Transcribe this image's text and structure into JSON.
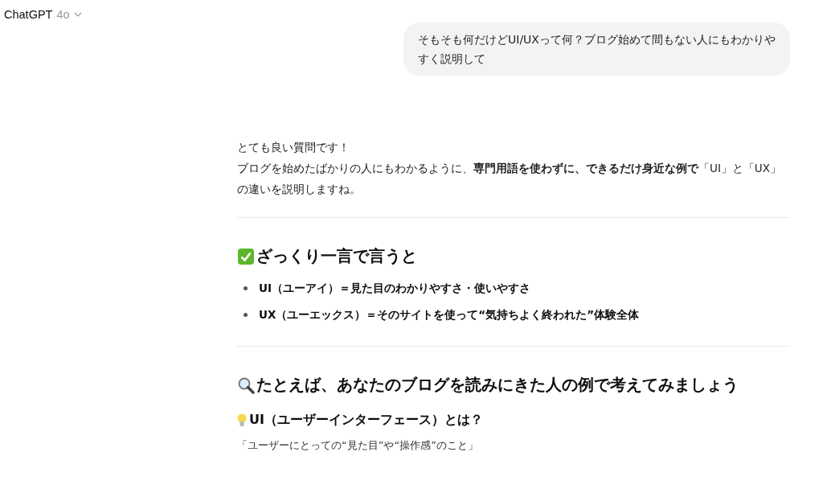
{
  "header": {
    "app_name": "ChatGPT",
    "model": "4o"
  },
  "user_message": "そもそも何だけどUI/UXって何？ブログ始めて間もない人にもわかりやすく説明して",
  "reply": {
    "paragraphs": [
      "とても良い質問です！",
      "ブログを始めたばかりの人にもわかるように、**専門用語を使わずに、できるだけ身近な例で**「UI」と「UX」の違いを説明しますね。"
    ],
    "sections": [
      {
        "kind": "summary",
        "heading": "ざっくり一言で言うと",
        "bullets": [
          "UI（ユーアイ）＝見た目のわかりやすさ・使いやすさ",
          "UX（ユーエックス）＝そのサイトを使って“気持ちよく終われた”体験全体"
        ]
      },
      {
        "kind": "example",
        "heading": "たとえば、あなたのブログを読みにきた人の例で考えてみましょう",
        "subsections": [
          {
            "kind": "idea",
            "heading": "UI（ユーザーインターフェース）とは？",
            "text": "「ユーザーにとっての“見た目”や“操作感”のこと」"
          }
        ]
      }
    ]
  }
}
